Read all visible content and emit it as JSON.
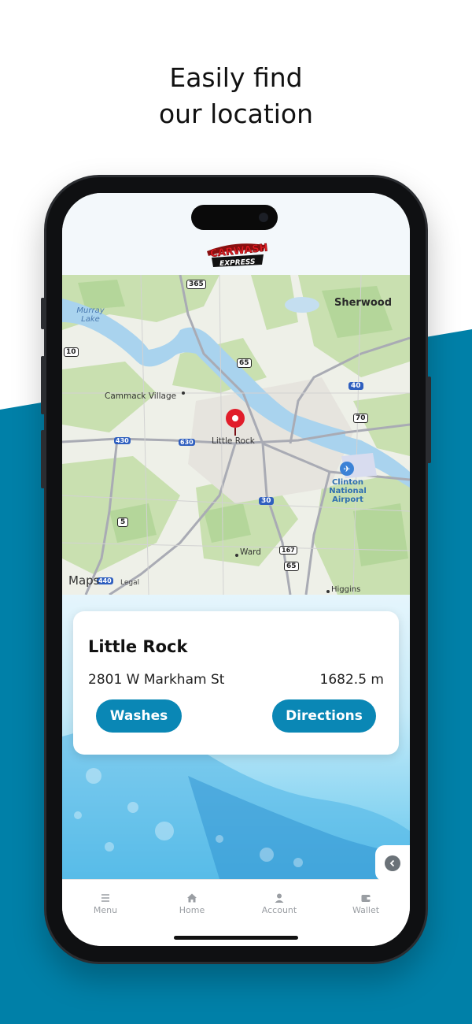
{
  "headline": {
    "line1": "Easily find",
    "line2": "our location"
  },
  "colors": {
    "brand_teal": "#0a87b5",
    "band_blue": "#0080a8",
    "pin_red": "#e11d2a",
    "nav_gray": "#9a9ea3"
  },
  "app": {
    "logo_text_top": "CARWASH",
    "logo_text_bottom": "EXPRESS"
  },
  "map": {
    "labels": {
      "sherwood": "Sherwood",
      "murray_lake": "Murray Lake",
      "cammack_village": "Cammack Village",
      "little_rock": "Little Rock",
      "airport": "Clinton National Airport",
      "ward": "Ward",
      "higgins": "Higgins",
      "maps": "Maps",
      "legal": "Legal"
    },
    "shields": {
      "s365": "365",
      "s10": "10",
      "s65a": "65",
      "s40": "40",
      "s70": "70",
      "s430": "430",
      "s630": "630",
      "s30": "30",
      "s5": "5",
      "s167": "167",
      "s65b": "65",
      "s440": "440"
    },
    "pin_icon": "map-pin-icon",
    "airport_icon": "airplane-icon",
    "apple_icon": "apple-logo-icon"
  },
  "location": {
    "name": "Little Rock",
    "address": "2801 W Markham St",
    "distance": "1682.5 m",
    "washes_label": "Washes",
    "directions_label": "Directions"
  },
  "side_tab": {
    "icon": "chevron-left-icon"
  },
  "nav": [
    {
      "label": "Menu",
      "icon": "menu-icon"
    },
    {
      "label": "Home",
      "icon": "home-icon"
    },
    {
      "label": "Account",
      "icon": "account-icon"
    },
    {
      "label": "Wallet",
      "icon": "wallet-icon"
    }
  ]
}
